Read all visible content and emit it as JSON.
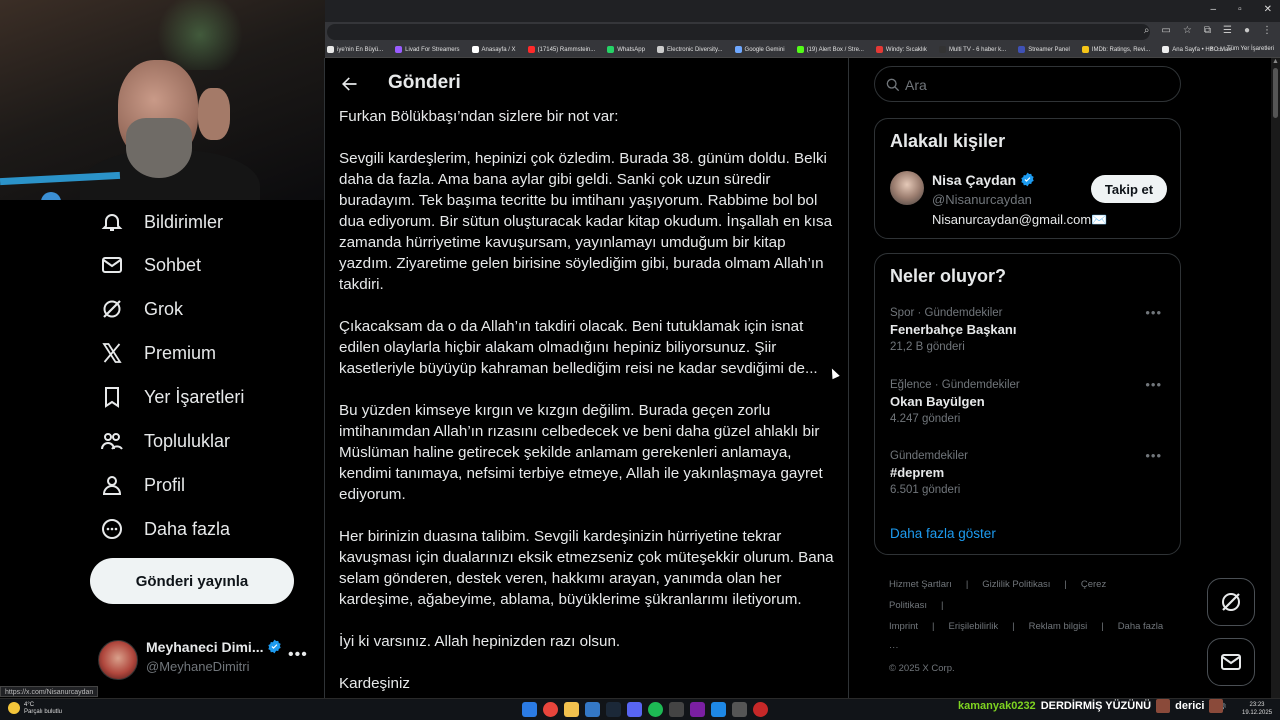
{
  "browser": {
    "window_controls": [
      "–",
      "▫",
      "✕"
    ],
    "bookmarks": [
      {
        "label": "iye'nin En Büyü...",
        "color": "#e8e8e8"
      },
      {
        "label": "Livad For Streamers",
        "color": "#9a5cff"
      },
      {
        "label": "Anasayfa / X",
        "color": "#ffffff"
      },
      {
        "label": "(17145) Rammstein...",
        "color": "#ff2a2a"
      },
      {
        "label": "WhatsApp",
        "color": "#25d366"
      },
      {
        "label": "Electronic Diversity...",
        "color": "#cccccc"
      },
      {
        "label": "Google Gemini",
        "color": "#6fa8ff"
      },
      {
        "label": "(19) Alert Box / Stre...",
        "color": "#53fc18"
      },
      {
        "label": "Windy: Sıcaklık",
        "color": "#e53935"
      },
      {
        "label": "Multi TV - 6 haber k...",
        "color": "#333333"
      },
      {
        "label": "Streamer Panel",
        "color": "#3f51b5"
      },
      {
        "label": "IMDb: Ratings, Revi...",
        "color": "#f5c518"
      },
      {
        "label": "Ana Sayfa • HBO Max",
        "color": "#eeeeee"
      }
    ],
    "bookmarks_overflow": "»",
    "all_bookmarks": "Tüm Yer İşaretleri",
    "status_url": "https://x.com/Nisanurcaydan"
  },
  "nav": {
    "items": [
      {
        "label": "Bildirimler",
        "icon": "bell-icon"
      },
      {
        "label": "Sohbet",
        "icon": "mail-icon"
      },
      {
        "label": "Grok",
        "icon": "grok-icon"
      },
      {
        "label": "Premium",
        "icon": "x-logo-icon"
      },
      {
        "label": "Yer İşaretleri",
        "icon": "bookmark-icon"
      },
      {
        "label": "Topluluklar",
        "icon": "people-icon"
      },
      {
        "label": "Profil",
        "icon": "profile-icon"
      },
      {
        "label": "Daha fazla",
        "icon": "more-circle-icon"
      }
    ],
    "post_button": "Gönderi yayınla",
    "account": {
      "name": "Meyhaneci Dimi...",
      "handle": "@MeyhaneDimitri",
      "more": "•••"
    }
  },
  "main": {
    "title": "Gönderi",
    "paragraphs": [
      "Furkan Bölükbaşı’ndan sizlere bir not var:",
      "Sevgili kardeşlerim, hepinizi çok özledim. Burada 38. günüm doldu. Belki daha da fazla. Ama bana aylar gibi geldi. Sanki çok uzun süredir buradayım. Tek başıma tecritte bu imtihanı yaşıyorum. Rabbime bol bol dua ediyorum. Bir sütun oluşturacak kadar kitap okudum. İnşallah en kısa zamanda hürriyetime kavuşursam, yayınlamayı umduğum bir kitap yazdım. Ziyaretime gelen birisine söylediğim gibi, burada olmam Allah’ın takdiri.",
      "Çıkacaksam da o da Allah’ın takdiri olacak. Beni tutuklamak için isnat edilen olaylarla hiçbir alakam olmadığını hepiniz biliyorsunuz. Şiir kasetleriyle büyüyüp kahraman bellediğim reisi ne kadar sevdiğimi de...",
      "Bu yüzden kimseye kırgın ve kızgın değilim. Burada geçen zorlu imtihanımdan Allah’ın rızasını celbedecek ve beni daha güzel ahlaklı bir Müslüman haline getirecek şekilde anlamam gerekenleri anlamaya, kendimi tanımaya, nefsimi terbiye etmeye, Allah ile yakınlaşmaya gayret ediyorum.",
      "Her birinizin duasına talibim. Sevgili kardeşinizin hürriyetine tekrar kavuşması için dualarınızı eksik etmezseniz çok müteşekkir olurum. Bana selam gönderen, destek veren, hakkımı arayan, yanımda olan her kardeşime, ağabeyime, ablama, büyüklerime şükranlarımı iletiyorum.",
      "İyi ki varsınız. Allah hepinizden razı olsun.",
      "Kardeşiniz"
    ]
  },
  "right": {
    "search_placeholder": "Ara",
    "related": {
      "title": "Alakalı kişiler",
      "name": "Nisa Çaydan",
      "handle": "@Nisanurcaydan",
      "bio": "Nisanurcaydan@gmail.com✉️",
      "follow": "Takip et"
    },
    "trends": {
      "title": "Neler oluyor?",
      "items": [
        {
          "category": "Spor · Gündemdekiler",
          "title": "Fenerbahçe Başkanı",
          "count": "21,2 B gönderi"
        },
        {
          "category": "Eğlence · Gündemdekiler",
          "title": "Okan Bayülgen",
          "count": "4.247 gönderi"
        },
        {
          "category": "Gündemdekiler",
          "title": "#deprem",
          "count": "6.501 gönderi"
        }
      ],
      "show_more": "Daha fazla göster",
      "more": "•••"
    },
    "footer": [
      "Hizmet Şartları",
      "|",
      "Gizlilik Politikası",
      "|",
      "Çerez Politikası",
      "|",
      "Imprint",
      "|",
      "Erişilebilirlik",
      "|",
      "Reklam bilgisi",
      "|",
      "Daha fazla ···",
      "© 2025 X Corp."
    ]
  },
  "taskbar": {
    "weather_temp": "4°C",
    "weather_desc": "Parçalı bulutlu",
    "chat_user": "kamanyak0232",
    "chat_msg1": "DERDİRMİŞ YÜZÜNÜ",
    "chat_msg2": "derici",
    "time": "23:23",
    "date": "19.12.2025"
  },
  "colors": {
    "accent": "#1d9bf0",
    "verified": "#1d9bf0",
    "background": "#000000",
    "chat_user": "#7ed321"
  }
}
